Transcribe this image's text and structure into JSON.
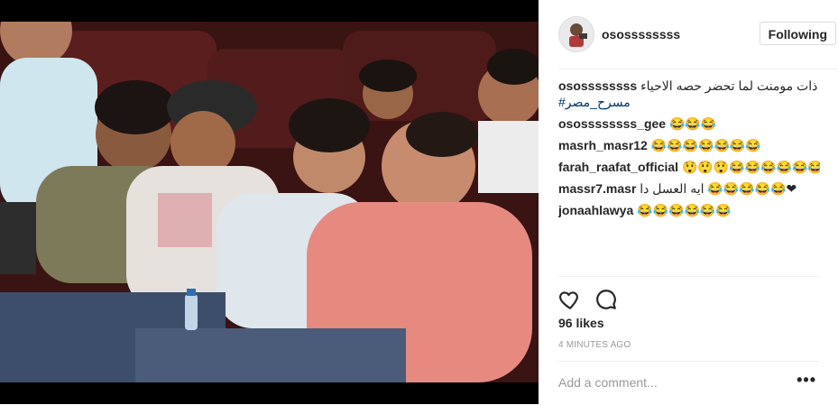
{
  "post": {
    "username": "osossssssss",
    "follow_label": "Following",
    "likes": "96 likes",
    "timestamp": "4 MINUTES AGO",
    "add_comment_placeholder": "Add a comment...",
    "more_label": "•••"
  },
  "caption": {
    "user": "osossssssss",
    "text": "ذات مومنت لما تحضر حصه الاحياء 😂❤",
    "hashtag": "#مسرح_مصر"
  },
  "comments": [
    {
      "user": "osossssssss_gee",
      "text": "😂😂😂"
    },
    {
      "user": "masrh_masr12",
      "text": "😂😂😂😂😂😂😂"
    },
    {
      "user": "farah_raafat_official",
      "text": "😲😲😲😂😂😂😂😂😂😂"
    },
    {
      "user": "massr7.masr",
      "text": "ايه العسل دا 😂😂😂😂😂❤"
    },
    {
      "user": "jonaahlawya",
      "text": "😂😂😂😂😂😂"
    }
  ],
  "icons": {
    "like": "heart-outline-icon",
    "comment": "speech-bubble-icon",
    "more": "ellipsis-icon"
  },
  "colors": {
    "photo_bg": "#3b1414",
    "border": "#efefef",
    "hashtag": "#003569",
    "muted": "#999999",
    "text": "#262626"
  }
}
